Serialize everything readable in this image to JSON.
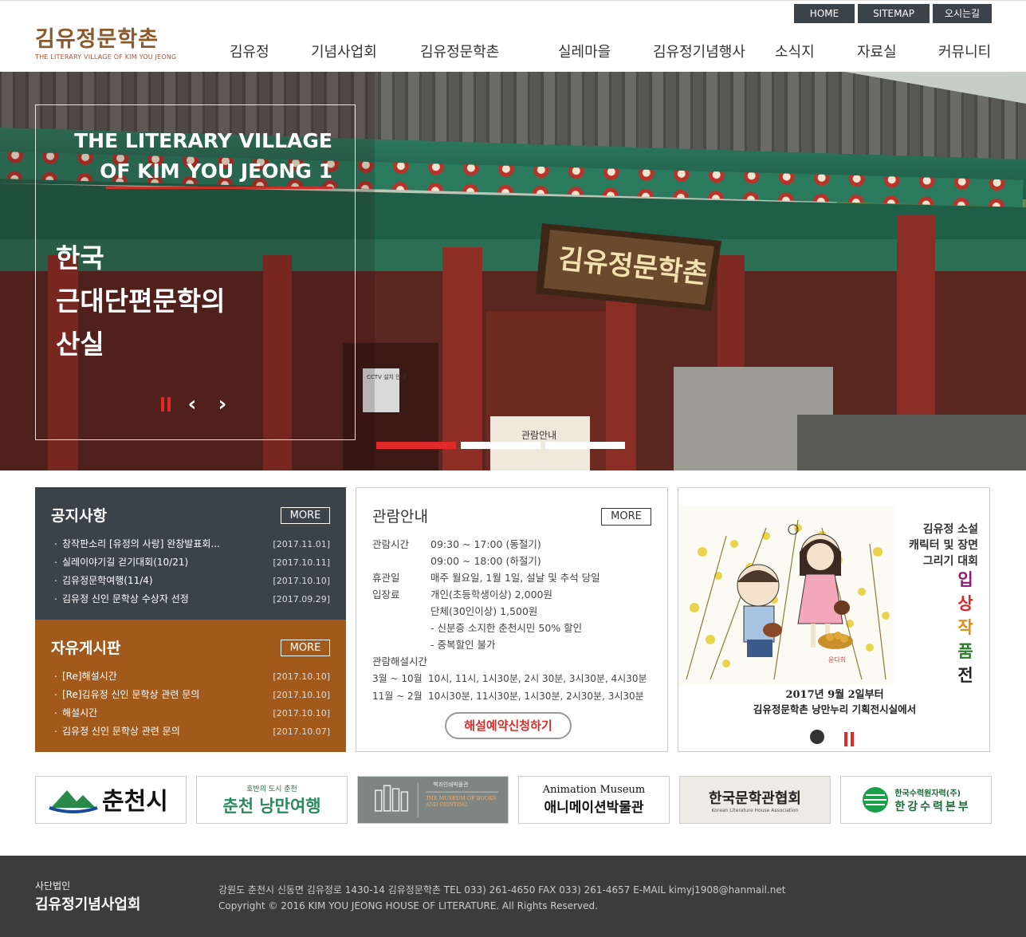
{
  "util_nav": [
    "HOME",
    "SITEMAP",
    "오시는길"
  ],
  "logo": {
    "ko": "김유정문학촌",
    "en": "THE LITERARY VILLAGE OF KIM YOU JEONG"
  },
  "gnb": [
    "김유정",
    "기념사업회",
    "김유정문학촌",
    "실레마을",
    "김유정기념행사",
    "소식지",
    "자료실",
    "커뮤니티"
  ],
  "hero": {
    "title_en_1": "THE LITERARY VILLAGE",
    "title_en_2": "OF KIM YOU JEONG 1",
    "title_ko_1": "한국",
    "title_ko_2": "근대단편문학의",
    "title_ko_3": "산실",
    "sign_text": "김유정문학촌",
    "sign2_text": "관람안내",
    "cctv_text": "CCTV 설치 안내",
    "active_slide": 1,
    "slides": 3
  },
  "notice": {
    "title": "공지사항",
    "more": "MORE",
    "items": [
      {
        "title": "창작판소리 [유정의 사랑] 완창발표회...",
        "date": "[2017.11.01]"
      },
      {
        "title": "실레이야기길 걷기대회(10/21)",
        "date": "[2017.10.11]"
      },
      {
        "title": "김유정문학여행(11/4)",
        "date": "[2017.10.10]"
      },
      {
        "title": "김유정 신인 문학상 수상자 선정",
        "date": "[2017.09.29]"
      }
    ]
  },
  "free": {
    "title": "자유게시판",
    "more": "MORE",
    "items": [
      {
        "title": "[Re]해설시간",
        "date": "[2017.10.10]"
      },
      {
        "title": "[Re]김유정 신인 문학상 관련 문의",
        "date": "[2017.10.10]"
      },
      {
        "title": "해설시간",
        "date": "[2017.10.10]"
      },
      {
        "title": "김유정 신인 문학상 관련 문의",
        "date": "[2017.10.07]"
      }
    ]
  },
  "info": {
    "title": "관람안내",
    "more": "MORE",
    "hours_label": "관람시간",
    "hours_1": "09:30 ~ 17:00 (동절기)",
    "hours_2": "09:00 ~ 18:00 (하절기)",
    "closed_label": "휴관일",
    "closed": "매주 월요일, 1월 1일, 설날 및 추석 당일",
    "fee_label": "입장료",
    "fee_1": "개인(초등학생이상) 2,000원",
    "fee_2": "단체(30인이상) 1,500원",
    "fee_3": "- 신분증 소지한 춘천시민 50% 할인",
    "fee_4": "- 중복할인 불가",
    "guide_label": "관람해설시간",
    "guide_1_period": "3월 ~ 10월",
    "guide_1_times": "10시, 11시, 1시30분, 2시 30분, 3시30분, 4시30분",
    "guide_2_period": "11월 ~ 2월",
    "guide_2_times": "10시30분, 11시30분, 1시30분, 2시30분, 3시30분",
    "reserve_button": "해설예약신청하기"
  },
  "promo": {
    "line1": "김유정 소설",
    "line2": "캐릭터 및 장면",
    "line3": "그리기 대회",
    "vertical": [
      "입",
      "상",
      "작",
      "품",
      "전"
    ],
    "vertical_colors": [
      "#8b1a7a",
      "#d8262a",
      "#e58b12",
      "#2a7a2a",
      "#222222"
    ],
    "caption1": "2017년 9월 2일부터",
    "caption2": "김유정문학촌 낭만누리 기획전시실에서",
    "signature": "윤다희"
  },
  "banners": [
    {
      "name": "춘천시",
      "label": "춘천시"
    },
    {
      "name": "춘천 낭만여행",
      "label_small": "호반의 도시 춘천",
      "label": "춘천 낭만여행"
    },
    {
      "name": "책과인쇄박물관",
      "label_small": "책과인쇄박물관",
      "label": "THE MUSEUM OF BOOKS AND PRINTING"
    },
    {
      "name": "애니메이션박물관",
      "label_small": "Animation Museum",
      "label": "애니메이션박물관"
    },
    {
      "name": "한국문학관협회",
      "label": "한국문학관협회",
      "label_small": "Korean Literature House Association"
    },
    {
      "name": "한국수력원자력 한강수력본부",
      "label_small": "한국수력원자력(주)",
      "label": "한강수력본부"
    }
  ],
  "footer": {
    "org_small": "사단법인",
    "org_name": "김유정기념사업회",
    "address": "강원도 춘천시 신동면 김유정로 1430-14 김유정문학촌   TEL 033) 261-4650    FAX 033) 261-4657    E-MAIL kimyj1908@hanmail.net",
    "copyright": "Copyright © 2016 KIM YOU JEONG HOUSE OF LITERATURE. All Rights Reserved."
  },
  "colors": {
    "accent_red": "#e02a2a",
    "notice_bg": "#3a424a",
    "free_bg": "#a15a1c",
    "footer_bg": "#3c3c3c",
    "logo_brown": "#8b5a2b"
  }
}
